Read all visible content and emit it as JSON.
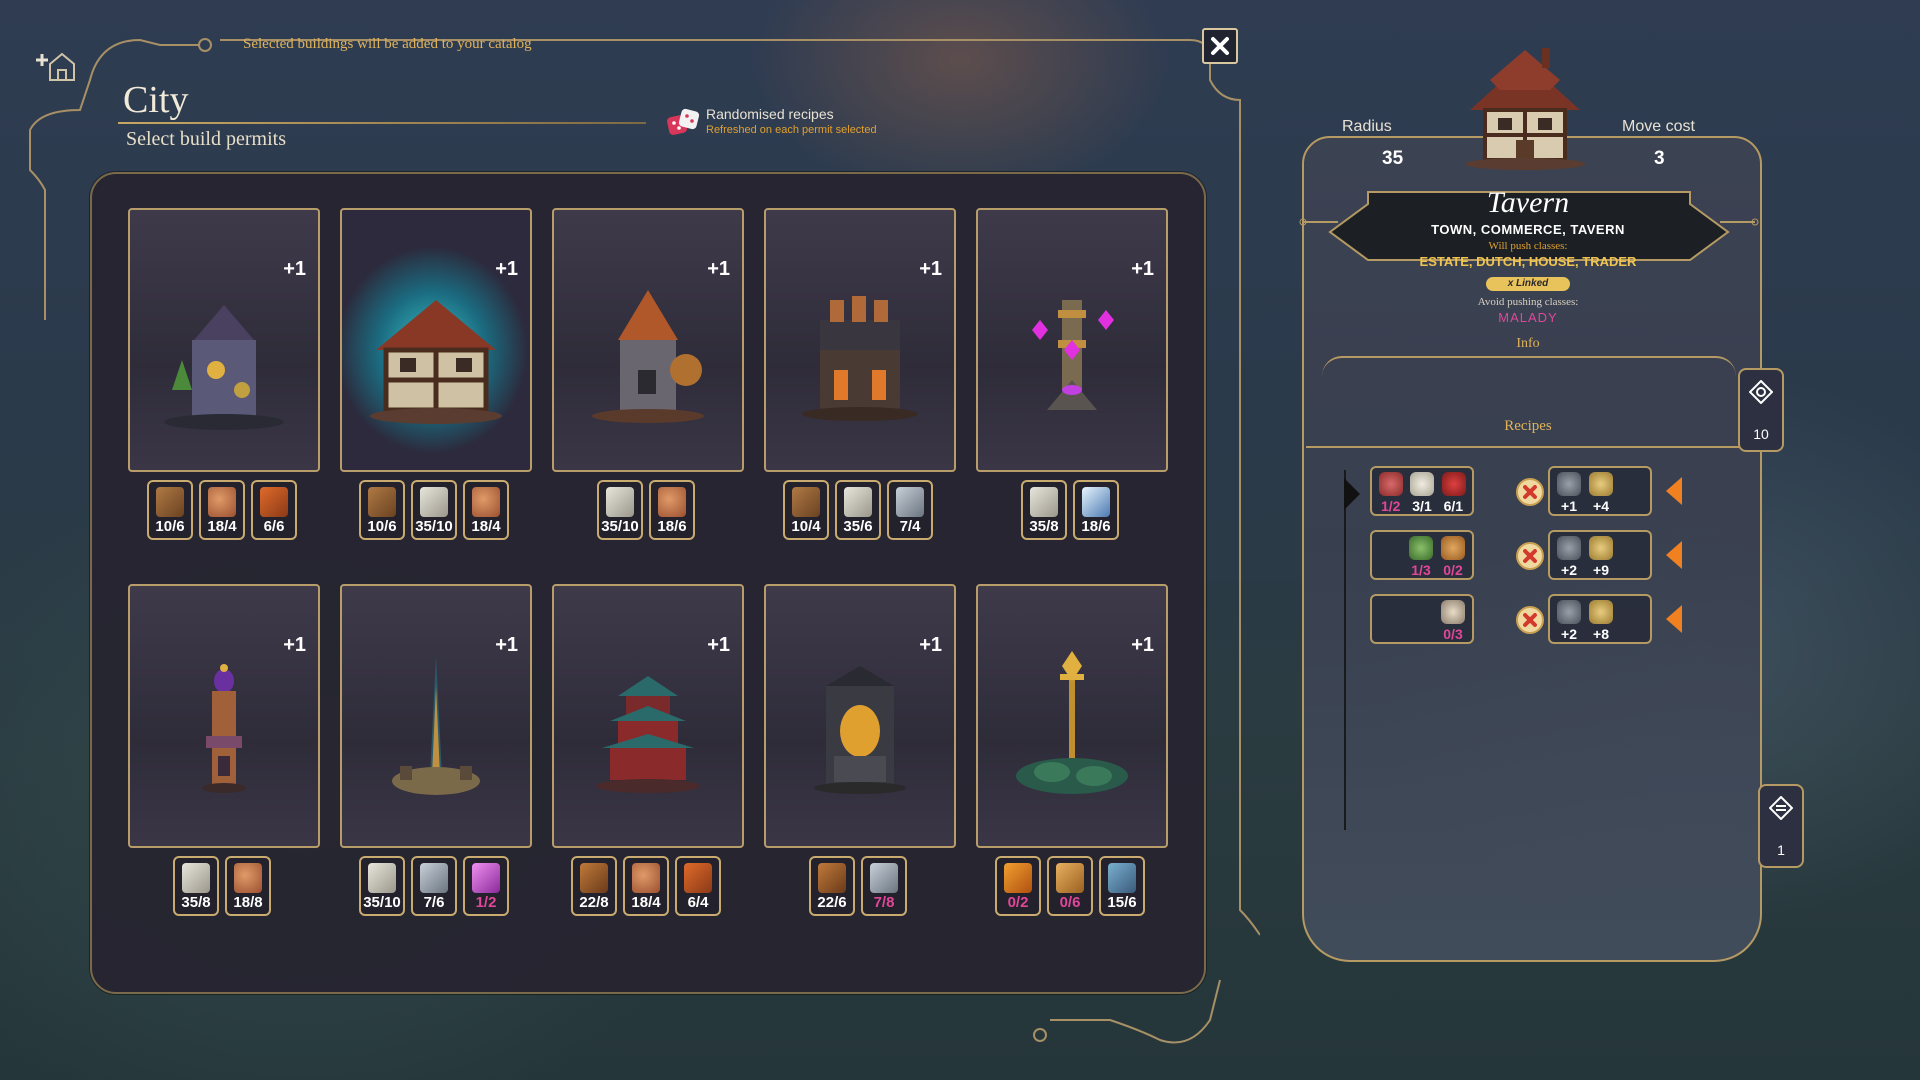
{
  "header": {
    "hint": "Selected buildings will be added to your catalog",
    "title": "City",
    "subtitle": "Select build permits",
    "randomised_title": "Randomised recipes",
    "randomised_sub": "Refreshed on each permit selected"
  },
  "icons": {
    "add_building": "add-building-icon",
    "close": "close-icon",
    "dice": "dice-icon"
  },
  "colors": {
    "accent_gold": "#e0b35a",
    "shortage_pink": "#e0479a",
    "linked_badge": "#e8c25a"
  },
  "cards": [
    {
      "bonus": "+1",
      "selected": false,
      "resources": [
        {
          "icon": "wood-icon",
          "text": "10/6",
          "short": false
        },
        {
          "icon": "clay-icon",
          "text": "18/4",
          "short": false
        },
        {
          "icon": "brick-icon",
          "text": "6/6",
          "short": false
        }
      ]
    },
    {
      "bonus": "+1",
      "selected": true,
      "resources": [
        {
          "icon": "wood-icon",
          "text": "10/6",
          "short": false
        },
        {
          "icon": "stone-icon",
          "text": "35/10",
          "short": false
        },
        {
          "icon": "clay-icon",
          "text": "18/4",
          "short": false
        }
      ]
    },
    {
      "bonus": "+1",
      "selected": false,
      "resources": [
        {
          "icon": "stone-icon",
          "text": "35/10",
          "short": false
        },
        {
          "icon": "clay-icon",
          "text": "18/6",
          "short": false
        }
      ]
    },
    {
      "bonus": "+1",
      "selected": false,
      "resources": [
        {
          "icon": "wood-icon",
          "text": "10/4",
          "short": false
        },
        {
          "icon": "stone-icon",
          "text": "35/6",
          "short": false
        },
        {
          "icon": "iron-icon",
          "text": "7/4",
          "short": false
        }
      ]
    },
    {
      "bonus": "+1",
      "selected": false,
      "resources": [
        {
          "icon": "stone-icon",
          "text": "35/8",
          "short": false
        },
        {
          "icon": "crystal-icon",
          "text": "18/6",
          "short": false
        }
      ]
    },
    {
      "bonus": "+1",
      "selected": false,
      "resources": [
        {
          "icon": "stone-icon",
          "text": "35/8",
          "short": false
        },
        {
          "icon": "clay-icon",
          "text": "18/8",
          "short": false
        }
      ]
    },
    {
      "bonus": "+1",
      "selected": false,
      "resources": [
        {
          "icon": "stone-icon",
          "text": "35/10",
          "short": false
        },
        {
          "icon": "iron-icon",
          "text": "7/6",
          "short": false
        },
        {
          "icon": "potion-icon",
          "text": "1/2",
          "short": true
        }
      ]
    },
    {
      "bonus": "+1",
      "selected": false,
      "resources": [
        {
          "icon": "chest-icon",
          "text": "22/8",
          "short": false
        },
        {
          "icon": "clay-icon",
          "text": "18/4",
          "short": false
        },
        {
          "icon": "brick-icon",
          "text": "6/4",
          "short": false
        }
      ]
    },
    {
      "bonus": "+1",
      "selected": false,
      "resources": [
        {
          "icon": "chest-icon",
          "text": "22/6",
          "short": false
        },
        {
          "icon": "iron-icon",
          "text": "7/8",
          "short": true
        }
      ]
    },
    {
      "bonus": "+1",
      "selected": false,
      "resources": [
        {
          "icon": "gold-bar-icon",
          "text": "0/2",
          "short": true
        },
        {
          "icon": "wheat-icon",
          "text": "0/6",
          "short": true
        },
        {
          "icon": "bucket-icon",
          "text": "15/6",
          "short": false
        }
      ]
    }
  ],
  "detail": {
    "radius_label": "Radius",
    "radius_value": "35",
    "move_label": "Move cost",
    "move_value": "3",
    "name": "Tavern",
    "classes": "TOWN, COMMERCE, TAVERN",
    "push_label": "Will push classes:",
    "push_classes": "ESTATE, DUTCH, HOUSE, TRADER",
    "linked": "x Linked",
    "avoid_label": "Avoid pushing classes:",
    "avoid_value": "MALADY",
    "info_label": "Info",
    "recipes_label": "Recipes",
    "side_top_count": "10",
    "side_bottom_count": "1"
  },
  "recipes": [
    {
      "inputs": [
        {
          "icon": "meat-icon",
          "text": "1/2",
          "short": true
        },
        {
          "icon": "egg-icon",
          "text": "3/1",
          "short": false
        },
        {
          "icon": "berry-icon",
          "text": "6/1",
          "short": false
        }
      ],
      "outputs": [
        {
          "icon": "lock-icon",
          "text": "+1"
        },
        {
          "icon": "coin-icon",
          "text": "+4"
        }
      ]
    },
    {
      "inputs": [
        {
          "icon": "salad-icon",
          "text": "1/3",
          "short": true
        },
        {
          "icon": "bread-icon",
          "text": "0/2",
          "short": true
        }
      ],
      "outputs": [
        {
          "icon": "lock-icon",
          "text": "+2"
        },
        {
          "icon": "coin-icon",
          "text": "+9"
        }
      ]
    },
    {
      "inputs": [
        {
          "icon": "mushroom-icon",
          "text": "0/3",
          "short": true
        }
      ],
      "outputs": [
        {
          "icon": "lock-icon",
          "text": "+2"
        },
        {
          "icon": "coin-icon",
          "text": "+8"
        }
      ]
    }
  ]
}
